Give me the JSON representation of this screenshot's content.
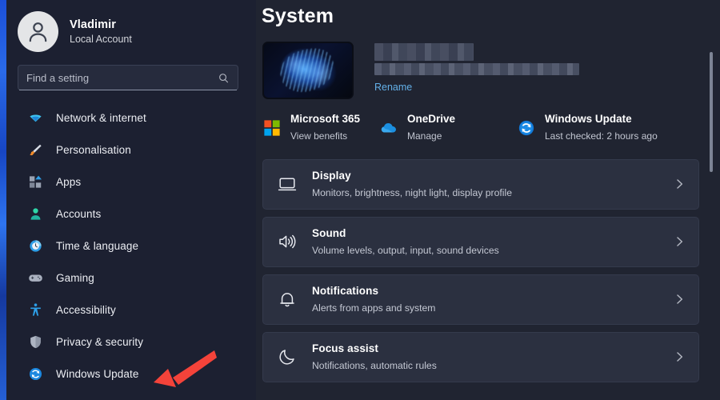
{
  "window": {
    "accent_color": "#63b0e8",
    "annotation_color": "#f4433a"
  },
  "sidebar": {
    "profile": {
      "name": "Vladimir",
      "account_type": "Local Account",
      "avatar_icon": "person-icon"
    },
    "search": {
      "placeholder": "Find a setting",
      "value": "",
      "icon": "search-icon"
    },
    "items": [
      {
        "label": "Network & internet",
        "icon": "wifi-icon"
      },
      {
        "label": "Personalisation",
        "icon": "paintbrush-icon"
      },
      {
        "label": "Apps",
        "icon": "apps-icon"
      },
      {
        "label": "Accounts",
        "icon": "account-icon"
      },
      {
        "label": "Time & language",
        "icon": "clock-icon"
      },
      {
        "label": "Gaming",
        "icon": "gamepad-icon"
      },
      {
        "label": "Accessibility",
        "icon": "accessibility-icon"
      },
      {
        "label": "Privacy & security",
        "icon": "shield-icon"
      },
      {
        "label": "Windows Update",
        "icon": "windows-update-icon"
      }
    ]
  },
  "main": {
    "title": "System",
    "device": {
      "thumbnail_icon": "windows-bloom-wallpaper",
      "name_redacted": true,
      "model_redacted": true,
      "rename_label": "Rename"
    },
    "quick_links": [
      {
        "title": "Microsoft 365",
        "subtitle": "View benefits",
        "icon": "microsoft-logo-icon"
      },
      {
        "title": "OneDrive",
        "subtitle": "Manage",
        "icon": "onedrive-cloud-icon"
      },
      {
        "title": "Windows Update",
        "subtitle": "Last checked: 2 hours ago",
        "icon": "windows-update-icon"
      }
    ],
    "cards": [
      {
        "title": "Display",
        "subtitle": "Monitors, brightness, night light, display profile",
        "icon": "monitor-icon"
      },
      {
        "title": "Sound",
        "subtitle": "Volume levels, output, input, sound devices",
        "icon": "speaker-icon"
      },
      {
        "title": "Notifications",
        "subtitle": "Alerts from apps and system",
        "icon": "bell-icon"
      },
      {
        "title": "Focus assist",
        "subtitle": "Notifications, automatic rules",
        "icon": "moon-icon"
      }
    ]
  }
}
